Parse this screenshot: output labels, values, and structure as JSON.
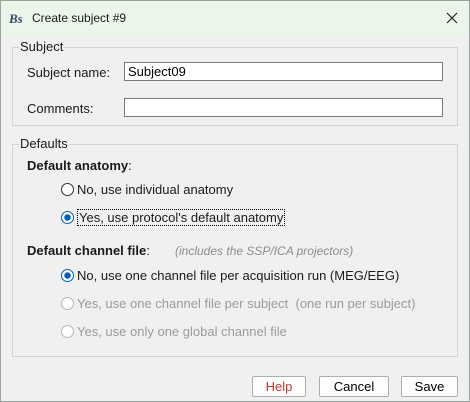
{
  "window": {
    "title": "Create subject #9",
    "app_icon": "brainstorm-logo-icon",
    "close_icon": "close-icon"
  },
  "subject_group": {
    "title": "Subject",
    "name_label": "Subject name:",
    "name_value": "Subject09",
    "comments_label": "Comments:",
    "comments_value": ""
  },
  "defaults_group": {
    "title": "Defaults",
    "anatomy": {
      "heading": "Default anatomy",
      "options": [
        {
          "label": "No, use individual anatomy",
          "selected": false,
          "enabled": true
        },
        {
          "label": "Yes, use protocol's default anatomy",
          "selected": true,
          "enabled": true
        }
      ]
    },
    "channel": {
      "heading": "Default channel file",
      "note": "(includes the SSP/ICA projectors)",
      "options": [
        {
          "label": "No, use one channel file per acquisition run (MEG/EEG)",
          "selected": true,
          "enabled": true
        },
        {
          "label": "Yes, use one channel file per subject  (one run per subject)",
          "selected": false,
          "enabled": false
        },
        {
          "label": "Yes, use only one global channel file",
          "selected": false,
          "enabled": false
        }
      ]
    },
    "colon": ":"
  },
  "buttons": {
    "help": "Help",
    "cancel": "Cancel",
    "save": "Save"
  },
  "colors": {
    "titlebar": "#e9f6e9",
    "dialog_bg": "#f0f0f0",
    "radio_selected": "#005fb8",
    "help_text": "#c0392b",
    "disabled_text": "#9b9b9b"
  }
}
